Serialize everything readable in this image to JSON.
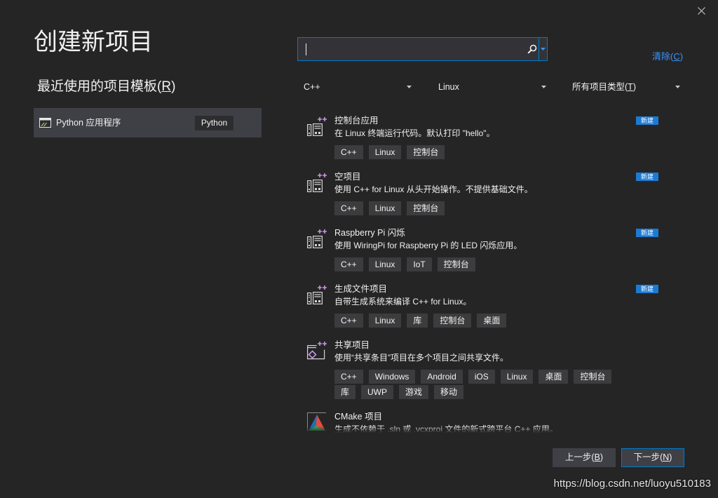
{
  "window": {
    "close_icon": "close-icon"
  },
  "page_title": "创建新项目",
  "recent": {
    "heading": "最近使用的项目模板(R)",
    "items": [
      {
        "icon": "window-app-icon",
        "label": "Python 应用程序",
        "language_tag": "Python"
      }
    ]
  },
  "search": {
    "value": "",
    "search_icon": "search-icon",
    "history_icon": "chevron-down-icon"
  },
  "clear_label": "清除(C)",
  "filters": [
    {
      "label": "C++",
      "icon": "chevron-down-icon"
    },
    {
      "label": "Linux",
      "icon": "chevron-down-icon"
    },
    {
      "label": "所有项目类型(T)",
      "icon": "chevron-down-icon"
    }
  ],
  "templates": [
    {
      "icon": "linux-console-icon",
      "title": "控制台应用",
      "description": "在 Linux 终端运行代码。默认打印 \"hello\"。",
      "tags": [
        "C++",
        "Linux",
        "控制台"
      ],
      "badge": "新建"
    },
    {
      "icon": "linux-console-icon",
      "title": "空项目",
      "description": "使用 C++ for Linux 从头开始操作。不提供基础文件。",
      "tags": [
        "C++",
        "Linux",
        "控制台"
      ],
      "badge": "新建"
    },
    {
      "icon": "linux-console-icon",
      "title": "Raspberry Pi 闪烁",
      "description": "使用 WiringPi for Raspberry Pi 的 LED 闪烁应用。",
      "tags": [
        "C++",
        "Linux",
        "IoT",
        "控制台"
      ],
      "badge": "新建"
    },
    {
      "icon": "linux-console-icon",
      "title": "生成文件项目",
      "description": "自带生成系统来编译 C++ for Linux。",
      "tags": [
        "C++",
        "Linux",
        "库",
        "控制台",
        "桌面"
      ],
      "badge": "新建"
    },
    {
      "icon": "shared-project-icon",
      "title": "共享项目",
      "description": "使用“共享条目”项目在多个项目之间共享文件。",
      "tags": [
        "C++",
        "Windows",
        "Android",
        "iOS",
        "Linux",
        "桌面",
        "控制台",
        "库",
        "UWP",
        "游戏",
        "移动"
      ]
    },
    {
      "icon": "cmake-icon",
      "title": "CMake 项目",
      "description": "生成不依赖于 .sln 或 .vcxproj 文件的新式跨平台 C++ 应用。",
      "tags": []
    }
  ],
  "buttons": {
    "back_label": "上一步(B)",
    "next_label": "下一步(N)"
  },
  "watermark": "https://blog.csdn.net/luoyu510183",
  "colors": {
    "background": "#252526",
    "accent": "#007acc",
    "link": "#3794ff",
    "badge": "#1c7ad4",
    "icon_plus": "#c792ea"
  }
}
